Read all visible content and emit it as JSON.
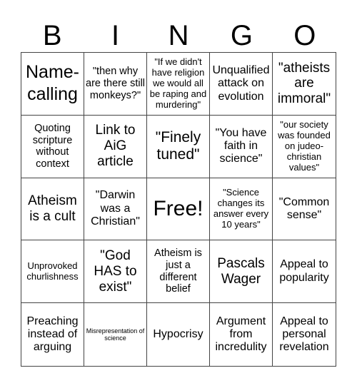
{
  "header": {
    "letters": [
      "B",
      "I",
      "N",
      "G",
      "O"
    ]
  },
  "cells": [
    "Name-calling",
    "\"then why are there still monkeys?\"",
    "\"If we didn't have religion we would all be raping and murdering\"",
    "Unqualified attack on evolution",
    "\"atheists are immoral\"",
    "Quoting scripture without context",
    "Link to AiG article",
    "\"Finely tuned\"",
    "\"You have faith in science\"",
    "\"our society was founded on judeo-christian values\"",
    "Atheism is a cult",
    "\"Darwin was a Christian\"",
    "Free!",
    "\"Science changes its answer every 10 years\"",
    "\"Common sense\"",
    "Unprovoked churlishness",
    "\"God HAS to exist\"",
    "Atheism is just a different belief",
    "Pascals Wager",
    "Appeal to popularity",
    "Preaching instead of arguing",
    "Misrepresentation of science",
    "Hypocrisy",
    "Argument from incredulity",
    "Appeal to personal revelation"
  ]
}
